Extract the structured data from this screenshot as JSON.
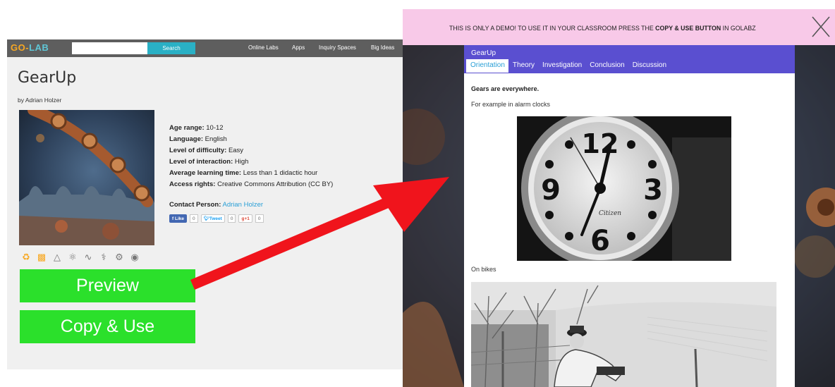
{
  "golab": {
    "logo_a": "GO-",
    "logo_b": "LAB",
    "search_placeholder": "",
    "search_label": "Search",
    "nav": [
      "Online Labs",
      "Apps",
      "Inquiry Spaces",
      "Big Ideas"
    ],
    "title": "GearUp",
    "author": "by Adrian Holzer",
    "meta": [
      {
        "label": "Age range:",
        "value": "10-12"
      },
      {
        "label": "Language:",
        "value": "English"
      },
      {
        "label": "Level of difficulty:",
        "value": "Easy"
      },
      {
        "label": "Level of interaction:",
        "value": "High"
      },
      {
        "label": "Average learning time:",
        "value": "Less than 1 didactic hour"
      },
      {
        "label": "Access rights:",
        "value": "Creative Commons Attribution (CC BY)"
      }
    ],
    "contact_label": "Contact Person:",
    "contact_name": "Adrian Holzer",
    "social": {
      "like_label": "Like",
      "like_count": "0",
      "tweet_label": "Tweet",
      "tweet_count": "0",
      "gplus_label": "+1",
      "gplus_count": "0"
    },
    "preview_button": "Preview",
    "copy_button": "Copy & Use",
    "colors": {
      "nav_bg": "#5e5e5e",
      "search_btn": "#2ab0c5",
      "button_green": "#2be02b",
      "link": "#2a9fd6"
    }
  },
  "preview": {
    "demo_notice_pre": "THIS IS ONLY A DEMO!  TO USE IT IN YOUR CLASSROOM PRESS THE ",
    "demo_notice_bold": "COPY & USE BUTTON",
    "demo_notice_post": " IN GOLABZ",
    "app_title": "GearUp",
    "tabs": [
      "Orientation",
      "Theory",
      "Investigation",
      "Conclusion",
      "Discussion"
    ],
    "active_tab": "Orientation",
    "heading": "Gears are everywhere.",
    "caption_clock": "For example in alarm clocks",
    "caption_bike": "On bikes",
    "clock_face": {
      "n12": "12",
      "n3": "3",
      "n6": "6",
      "n9": "9",
      "brand": "Citizen"
    },
    "colors": {
      "demo_bar": "#f8c9e8",
      "app_header": "#5a4fd0",
      "arrow": "#f0141c"
    }
  }
}
